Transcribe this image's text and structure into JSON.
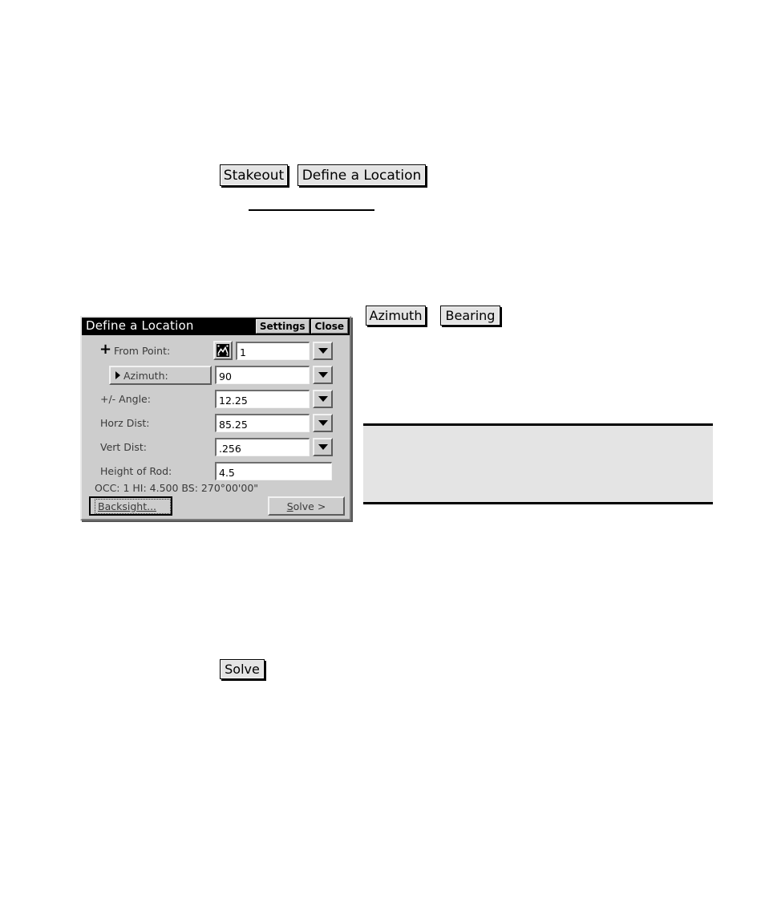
{
  "callouts": {
    "stakeout_button": "Stakeout",
    "define_location_button": "Define a Location",
    "azimuth_button": "Azimuth",
    "bearing_button": "Bearing",
    "solve_button": "Solve"
  },
  "dialog": {
    "title": "Define a Location",
    "titlebar": {
      "settings": "Settings",
      "close": "Close"
    },
    "fields": [
      {
        "label": "From Point:",
        "value": "1",
        "icon": "plus-icon",
        "picker": "point-picker-icon",
        "dropdown": true
      },
      {
        "label": "Azimuth:",
        "value": "90",
        "selector": true,
        "dropdown": true
      },
      {
        "label": "+/- Angle:",
        "value": "12.25",
        "dropdown": true
      },
      {
        "label": "Horz Dist:",
        "value": "85.25",
        "dropdown": true
      },
      {
        "label": "Vert Dist:",
        "value": ".256",
        "dropdown": true
      },
      {
        "label": "Height of Rod:",
        "value": "4.5",
        "dropdown": false
      }
    ],
    "status": "OCC: 1  HI: 4.500  BS: 270°00'00\"",
    "buttons": {
      "backsight": "Backsight...",
      "solve_prefix": "S",
      "solve_rest": "olve >"
    }
  },
  "colors": {
    "dialog_face": "#cdcdcd",
    "titlebar": "#000000",
    "field_bg": "#ffffff",
    "callout_face": "#e4e4e4",
    "note_box": "#e4e4e4"
  }
}
